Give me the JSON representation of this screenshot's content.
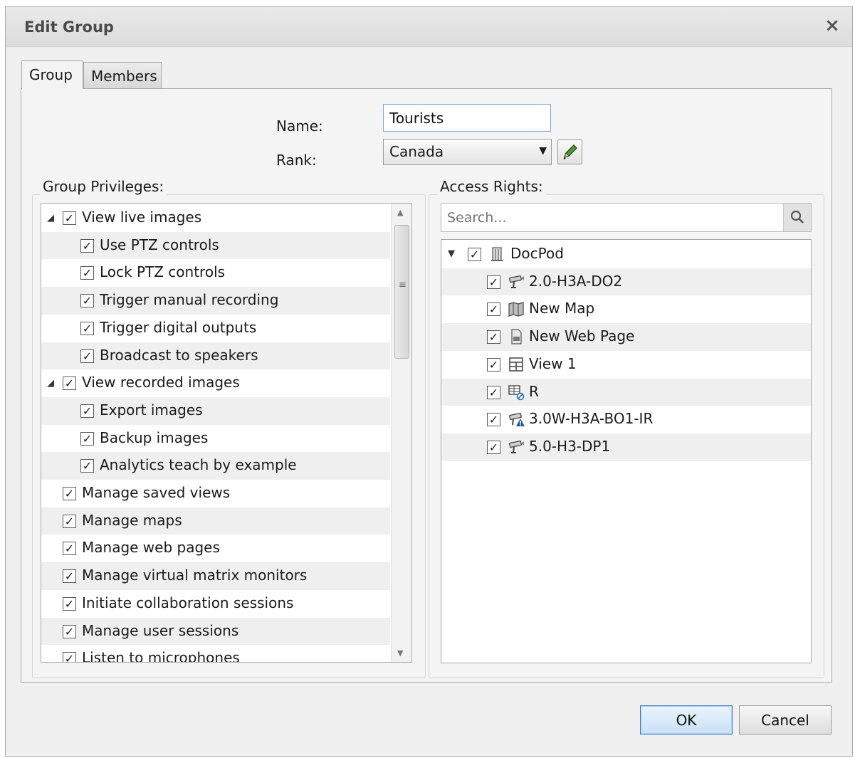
{
  "window": {
    "title": "Edit Group",
    "close_glyph": "×"
  },
  "tabs": [
    {
      "label": "Group",
      "active": true
    },
    {
      "label": "Members",
      "active": false
    }
  ],
  "form": {
    "name_label": "Name:",
    "name_value": "Tourists",
    "rank_label": "Rank:",
    "rank_value": "Canada",
    "rank_edit_icon": "pencil-icon"
  },
  "privileges": {
    "title": "Group Privileges:",
    "items": [
      {
        "label": "View live images",
        "level": 0,
        "expander": true,
        "checked": true
      },
      {
        "label": "Use PTZ controls",
        "level": 1,
        "checked": true
      },
      {
        "label": "Lock PTZ controls",
        "level": 1,
        "checked": true
      },
      {
        "label": "Trigger manual recording",
        "level": 1,
        "checked": true
      },
      {
        "label": "Trigger digital outputs",
        "level": 1,
        "checked": true
      },
      {
        "label": "Broadcast to speakers",
        "level": 1,
        "checked": true
      },
      {
        "label": "View recorded images",
        "level": 0,
        "expander": true,
        "checked": true
      },
      {
        "label": "Export images",
        "level": 1,
        "checked": true
      },
      {
        "label": "Backup images",
        "level": 1,
        "checked": true
      },
      {
        "label": "Analytics teach by example",
        "level": 1,
        "checked": true
      },
      {
        "label": "Manage saved views",
        "level": 0,
        "checked": true
      },
      {
        "label": "Manage maps",
        "level": 0,
        "checked": true
      },
      {
        "label": "Manage web pages",
        "level": 0,
        "checked": true
      },
      {
        "label": "Manage virtual matrix monitors",
        "level": 0,
        "checked": true
      },
      {
        "label": "Initiate collaboration sessions",
        "level": 0,
        "checked": true
      },
      {
        "label": "Manage user sessions",
        "level": 0,
        "checked": true
      },
      {
        "label": "Listen to microphones",
        "level": 0,
        "checked": true
      }
    ]
  },
  "access": {
    "title": "Access Rights:",
    "search_placeholder": "Search...",
    "search_icon": "magnifier-icon",
    "tree": [
      {
        "label": "DocPod",
        "level": 0,
        "expander": true,
        "icon": "site-icon",
        "checked": true
      },
      {
        "label": "2.0-H3A-DO2",
        "level": 1,
        "icon": "camera-icon",
        "checked": true
      },
      {
        "label": "New Map",
        "level": 1,
        "icon": "map-icon",
        "checked": true
      },
      {
        "label": "New Web Page",
        "level": 1,
        "icon": "web-page-icon",
        "checked": true
      },
      {
        "label": "View 1",
        "level": 1,
        "icon": "view-layout-icon",
        "checked": true
      },
      {
        "label": "R",
        "level": 1,
        "icon": "virtual-matrix-icon",
        "checked": true
      },
      {
        "label": "3.0W-H3A-BO1-IR",
        "level": 1,
        "icon": "camera-warning-icon",
        "checked": true
      },
      {
        "label": "5.0-H3-DP1",
        "level": 1,
        "icon": "camera-icon",
        "checked": true
      }
    ]
  },
  "buttons": {
    "ok": "OK",
    "cancel": "Cancel"
  },
  "colors": {
    "accent": "#3d7bc0",
    "warning": "#1e56a8",
    "dialog_bg": "#f0f0f0"
  }
}
